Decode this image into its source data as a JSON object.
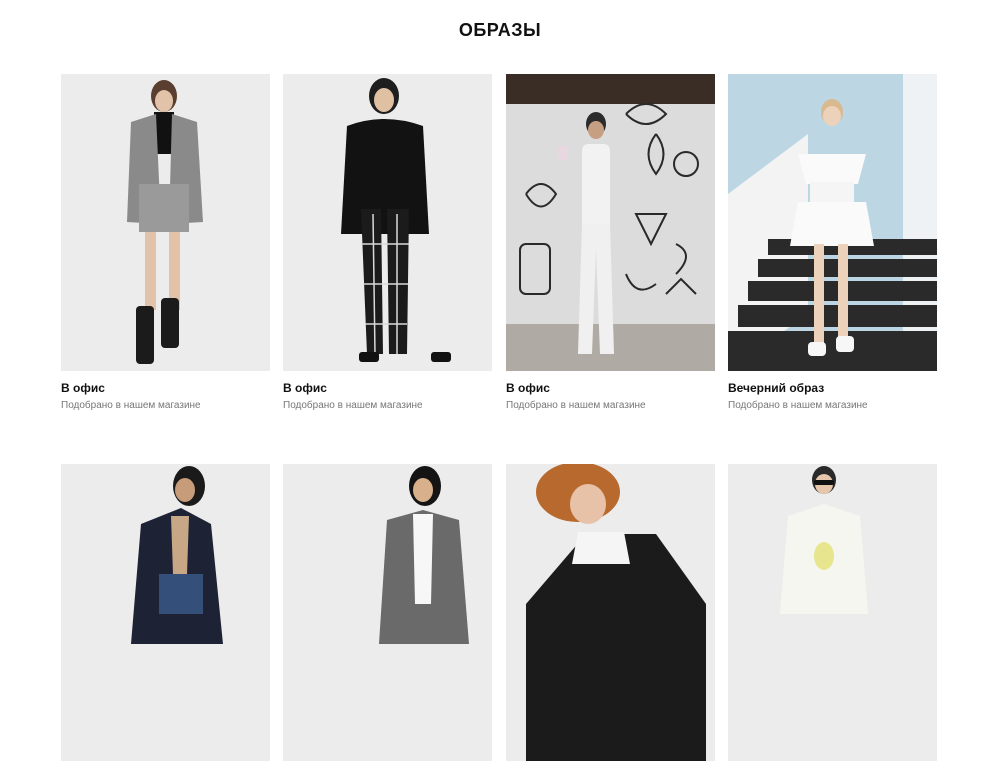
{
  "page": {
    "title": "ОБРАЗЫ"
  },
  "looks": [
    {
      "title": "В офис",
      "subtitle": "Подобрано в нашем магазине",
      "photo": "woman-houndstooth-jacket-skirt"
    },
    {
      "title": "В офис",
      "subtitle": "Подобрано в нашем магазине",
      "photo": "woman-black-blouse-check-trousers"
    },
    {
      "title": "В офис",
      "subtitle": "Подобрано в нашем магазине",
      "photo": "woman-white-jumpsuit-graffiti-wall"
    },
    {
      "title": "Вечерний образ",
      "subtitle": "Подобрано в нашем магазине",
      "photo": "woman-white-dress-stairs"
    },
    {
      "title": "",
      "subtitle": "",
      "photo": "woman-navy-blazer-jeans"
    },
    {
      "title": "",
      "subtitle": "",
      "photo": "woman-grey-blazer"
    },
    {
      "title": "",
      "subtitle": "",
      "photo": "woman-black-cardigan-curly-hair"
    },
    {
      "title": "",
      "subtitle": "",
      "photo": "woman-white-tshirt-sunglasses"
    }
  ],
  "colors": {
    "title": "#111111",
    "subtitle": "#777777",
    "photo_bg": "#ebebeb"
  }
}
